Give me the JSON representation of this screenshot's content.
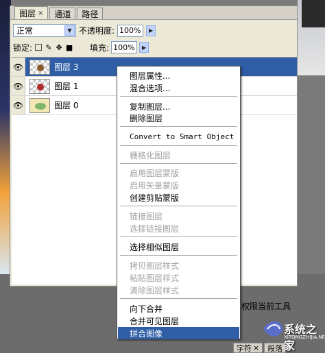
{
  "panel": {
    "tabs": [
      {
        "label": "图层",
        "close": "×"
      },
      {
        "label": "通道"
      },
      {
        "label": "路径"
      }
    ],
    "blend_mode": "正常",
    "opacity_label": "不透明度:",
    "opacity_value": "100%",
    "lock_label": "锁定:",
    "fill_label": "填充:",
    "fill_value": "100%"
  },
  "layers": [
    {
      "name": "图层 3",
      "selected": true
    },
    {
      "name": "图层 1"
    },
    {
      "name": "图层 0"
    }
  ],
  "menu": {
    "items": [
      {
        "label": "图层属性...",
        "enabled": true
      },
      {
        "label": "混合选项...",
        "enabled": true
      },
      {
        "label": "复制图层...",
        "enabled": true
      },
      {
        "label": "删除图层",
        "enabled": true
      },
      {
        "label": "Convert to Smart Object",
        "enabled": true
      },
      {
        "label": "栅格化图层",
        "enabled": false
      },
      {
        "label": "启用图层蒙版",
        "enabled": false
      },
      {
        "label": "启用矢量蒙版",
        "enabled": false
      },
      {
        "label": "创建剪贴蒙版",
        "enabled": true
      },
      {
        "label": "链接图层",
        "enabled": false
      },
      {
        "label": "选择链接图层",
        "enabled": false
      },
      {
        "label": "选择相似图层",
        "enabled": true
      },
      {
        "label": "拷贝图层样式",
        "enabled": false
      },
      {
        "label": "粘贴图层样式",
        "enabled": false
      },
      {
        "label": "清除图层样式",
        "enabled": false
      },
      {
        "label": "向下合并",
        "enabled": true
      },
      {
        "label": "合并可见图层",
        "enabled": true
      },
      {
        "label": "拼合图像",
        "enabled": true,
        "highlighted": true
      }
    ]
  },
  "bottom": {
    "tool_text": "权限当前工具",
    "tabs": [
      {
        "label": "字符",
        "close": "×"
      },
      {
        "label": "段落"
      }
    ],
    "watermark_text": "系统之家",
    "watermark_url": "XITONGZHIJIA.NET"
  },
  "colors": {
    "selection": "#2f5ea6",
    "panel_bg": "#ece9d8",
    "disabled_text": "#a0a0a0"
  },
  "icons": [
    "eye-icon",
    "lock-transparent-icon",
    "lock-paint-icon",
    "lock-move-icon",
    "lock-all-icon",
    "chevron-down-icon",
    "chevron-right-icon"
  ]
}
